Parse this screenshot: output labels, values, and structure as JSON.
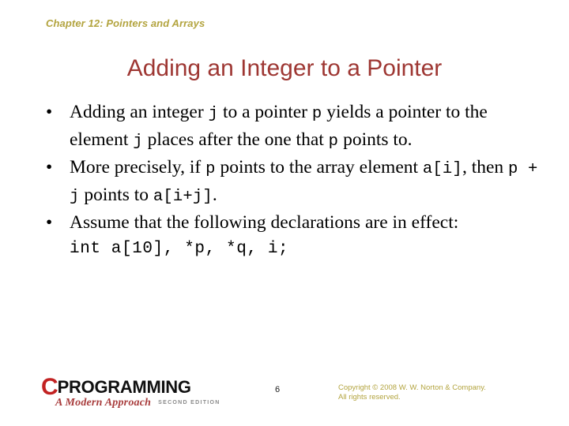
{
  "slide": {
    "chapter_header": "Chapter 12: Pointers and Arrays",
    "title": "Adding an Integer to a Pointer",
    "bullet_marker": "•",
    "bullets": [
      {
        "id": "bullet-adding-integer",
        "segments": [
          {
            "text": "Adding an integer ",
            "mono": false
          },
          {
            "text": "j",
            "mono": true
          },
          {
            "text": " to a pointer ",
            "mono": false
          },
          {
            "text": "p",
            "mono": true
          },
          {
            "text": " yields a pointer to the element ",
            "mono": false
          },
          {
            "text": "j",
            "mono": true
          },
          {
            "text": " places after the one that ",
            "mono": false
          },
          {
            "text": "p",
            "mono": true
          },
          {
            "text": " points to.",
            "mono": false
          }
        ]
      },
      {
        "id": "bullet-more-precisely",
        "segments": [
          {
            "text": "More precisely, if ",
            "mono": false
          },
          {
            "text": "p",
            "mono": true
          },
          {
            "text": " points to the array element ",
            "mono": false
          },
          {
            "text": "a[i]",
            "mono": true
          },
          {
            "text": ", then ",
            "mono": false
          },
          {
            "text": "p + j",
            "mono": true
          },
          {
            "text": " points to ",
            "mono": false
          },
          {
            "text": "a[i+j]",
            "mono": true
          },
          {
            "text": ".",
            "mono": false
          }
        ]
      },
      {
        "id": "bullet-assume-declarations",
        "segments": [
          {
            "text": "Assume that the following declarations are in effect:",
            "mono": false
          }
        ]
      }
    ],
    "code_line": "int a[10], *p, *q, i;"
  },
  "footer": {
    "logo": {
      "initial": "C",
      "word": "PROGRAMMING",
      "subtitle": "A Modern Approach",
      "edition": "SECOND EDITION"
    },
    "page_number": "6",
    "copyright_line1": "Copyright © 2008 W. W. Norton & Company.",
    "copyright_line2": "All rights reserved."
  },
  "colors": {
    "background": "#ffffff",
    "header_olive": "#b3a43f",
    "title_red": "#9e3733",
    "body_black": "#000000",
    "logo_red": "#c22222",
    "logo_subtitle_red": "#a83c3c",
    "edition_gray": "#8a8a8a"
  }
}
